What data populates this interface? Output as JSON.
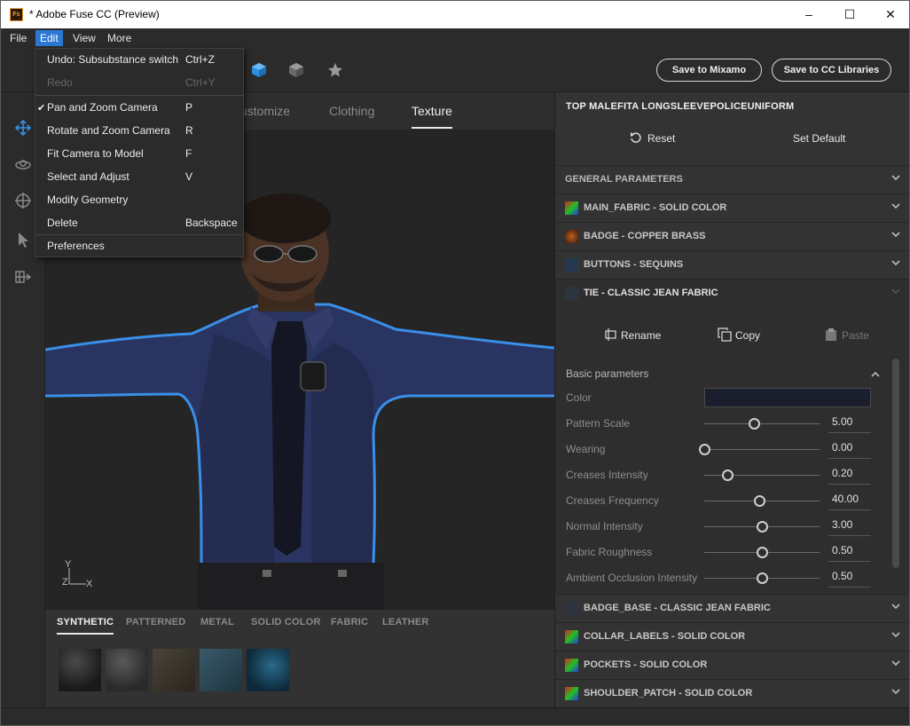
{
  "window": {
    "icon_text": "Fs",
    "title": "* Adobe Fuse CC (Preview)",
    "minimize": "–",
    "maximize": "☐",
    "close": "✕"
  },
  "menubar": {
    "items": [
      "File",
      "Edit",
      "View",
      "More"
    ]
  },
  "edit_menu": {
    "items": [
      {
        "label": "Undo: Subsubstance switch",
        "shortcut": "Ctrl+Z"
      },
      {
        "label": "Redo",
        "shortcut": "Ctrl+Y"
      },
      {
        "label": "Pan and Zoom Camera",
        "shortcut": "P"
      },
      {
        "label": "Rotate and Zoom Camera",
        "shortcut": "R"
      },
      {
        "label": "Fit Camera to Model",
        "shortcut": "F"
      },
      {
        "label": "Select and Adjust",
        "shortcut": "V"
      },
      {
        "label": "Modify Geometry",
        "shortcut": ""
      },
      {
        "label": "Delete",
        "shortcut": "Backspace"
      },
      {
        "label": "Preferences",
        "shortcut": ""
      }
    ],
    "check_mark": "✔"
  },
  "toolbar": {
    "save_mixamo": "Save to Mixamo",
    "save_cc": "Save to CC Libraries"
  },
  "tabs": {
    "customize": "ustomize",
    "clothing": "Clothing",
    "texture": "Texture"
  },
  "viewport": {
    "axis_y": "Y",
    "axis_z": "Z",
    "axis_x": "X"
  },
  "material_categories": [
    "SYNTHETIC",
    "PATTERNED",
    "METAL",
    "SOLID COLOR",
    "FABRIC",
    "LEATHER"
  ],
  "right_panel": {
    "title": "TOP MALEFITA LONGSLEEVEPOLICEUNIFORM",
    "reset": "Reset",
    "set_default": "Set Default",
    "general_parameters": "GENERAL PARAMETERS",
    "sections_top": [
      {
        "label": "MAIN_FABRIC - SOLID COLOR"
      },
      {
        "label": "BADGE - COPPER BRASS"
      },
      {
        "label": "BUTTONS - SEQUINS"
      },
      {
        "label": "TIE - CLASSIC JEAN FABRIC"
      }
    ],
    "tie": {
      "rename": "Rename",
      "copy": "Copy",
      "paste": "Paste",
      "basic_parameters": "Basic parameters",
      "color_label": "Color",
      "color_value": "#1b1e2c",
      "params": [
        {
          "label": "Pattern Scale",
          "value": "5.00",
          "level": 0.43
        },
        {
          "label": "Wearing",
          "value": "0.00",
          "level": 0.0
        },
        {
          "label": "Creases Intensity",
          "value": "0.20",
          "level": 0.2
        },
        {
          "label": "Creases Frequency",
          "value": "40.00",
          "level": 0.48
        },
        {
          "label": "Normal Intensity",
          "value": "3.00",
          "level": 0.5
        },
        {
          "label": "Fabric Roughness",
          "value": "0.50",
          "level": 0.5
        },
        {
          "label": "Ambient Occlusion Intensity",
          "value": "0.50",
          "level": 0.5
        }
      ]
    },
    "sections_bottom": [
      {
        "label": "BADGE_BASE - CLASSIC JEAN FABRIC"
      },
      {
        "label": "COLLAR_LABELS - SOLID COLOR"
      },
      {
        "label": "POCKETS - SOLID COLOR"
      },
      {
        "label": "SHOULDER_PATCH - SOLID COLOR"
      }
    ]
  },
  "colors": {
    "accent": "#2b78d4",
    "outline": "#3a8fe8",
    "background": "#323232"
  }
}
